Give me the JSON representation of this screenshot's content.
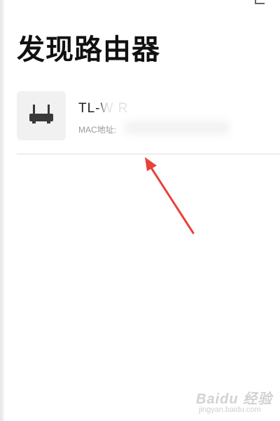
{
  "header": {
    "title": "发现路由器"
  },
  "routers": [
    {
      "name": "TL-W   R",
      "mac_label": "MAC地址:",
      "icon": "router-icon"
    }
  ],
  "annotation": {
    "arrow_color": "#e8423c"
  },
  "watermark": {
    "brand": "Baidu 经验",
    "domain": "jingyan.baidu.com"
  }
}
